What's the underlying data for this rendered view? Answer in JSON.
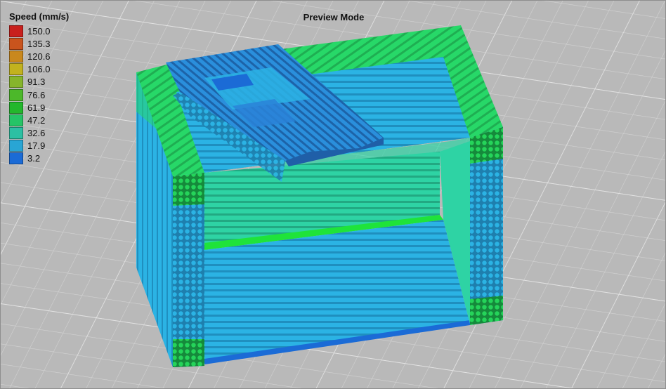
{
  "header": {
    "title": "Preview Mode"
  },
  "legend": {
    "title": "Speed (mm/s)",
    "entries": [
      {
        "value": "150.0",
        "color": "#c8201d"
      },
      {
        "value": "135.3",
        "color": "#c9541d"
      },
      {
        "value": "120.6",
        "color": "#c9881d"
      },
      {
        "value": "106.0",
        "color": "#c2b21e"
      },
      {
        "value": "91.3",
        "color": "#86b52b"
      },
      {
        "value": "76.6",
        "color": "#4cb82a"
      },
      {
        "value": "61.9",
        "color": "#23b72c"
      },
      {
        "value": "47.2",
        "color": "#25c466"
      },
      {
        "value": "32.6",
        "color": "#2cc0a3"
      },
      {
        "value": "17.9",
        "color": "#29a5d4"
      },
      {
        "value": "3.2",
        "color": "#1b6bd6"
      }
    ]
  },
  "model_colors": {
    "bright_green": "#1fe33a",
    "green": "#27d868",
    "teal": "#2ed3a4",
    "cyan": "#2bb3e4",
    "blue": "#2a82d8"
  }
}
